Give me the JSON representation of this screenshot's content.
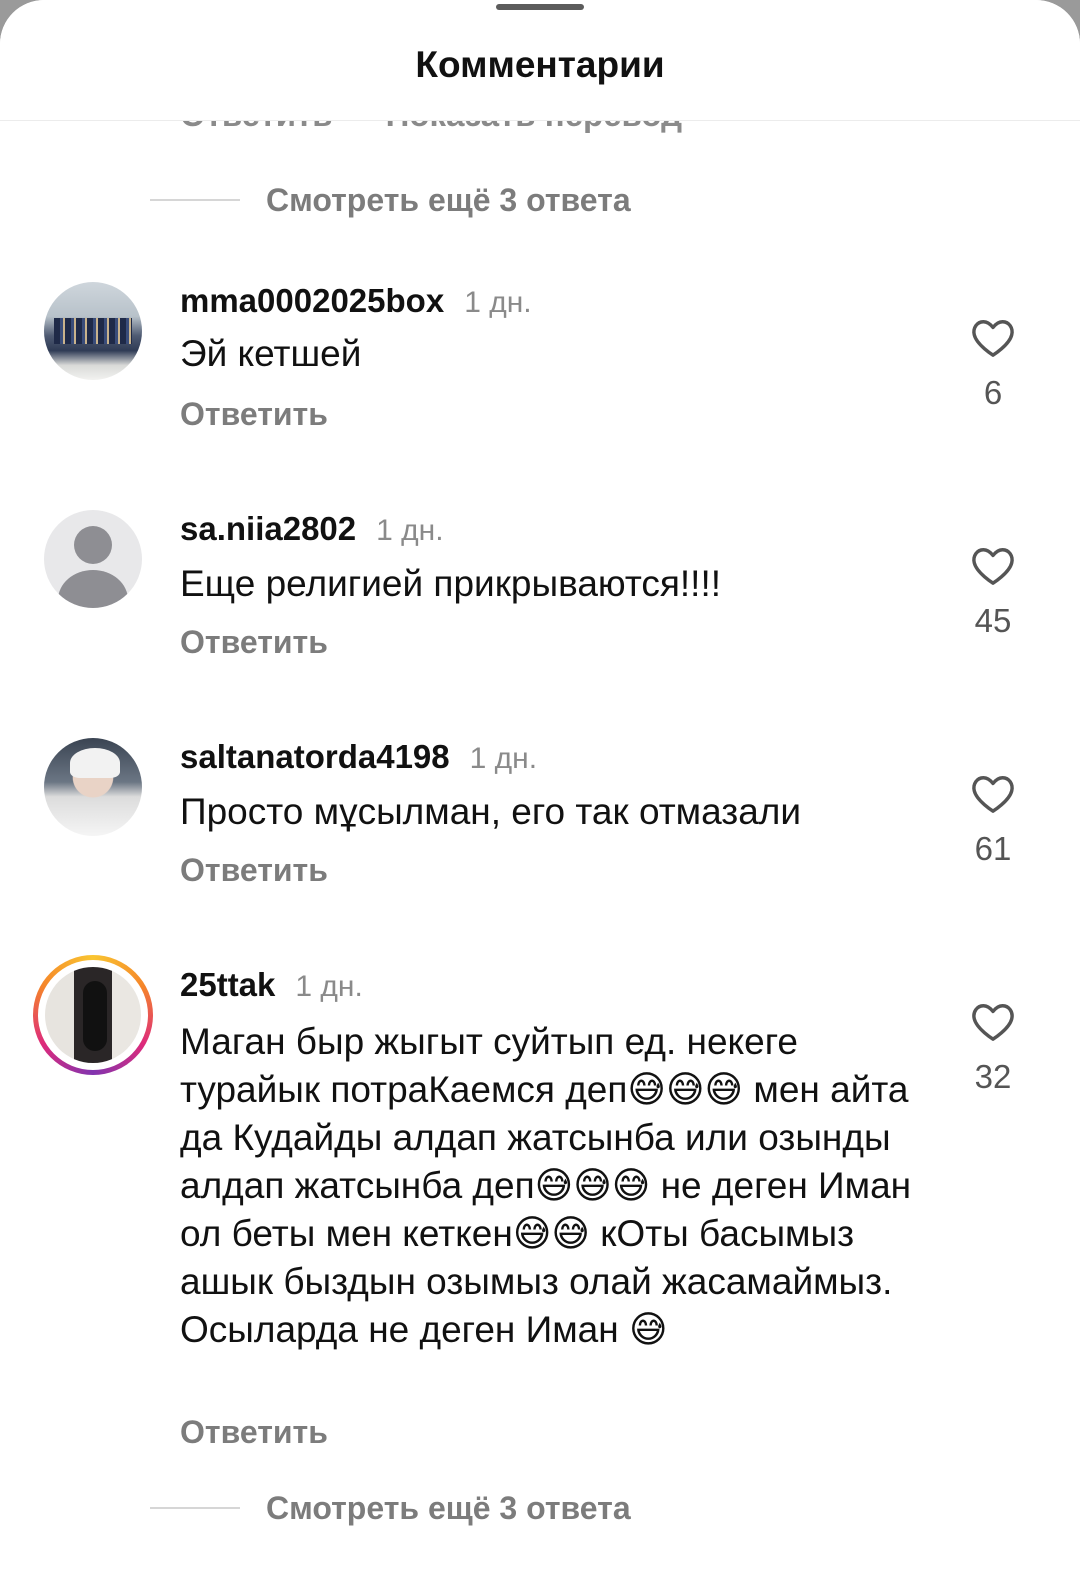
{
  "header": {
    "title": "Комментарии"
  },
  "clipped_row": {
    "reply_label": "Ответить",
    "translate_label": "Показать перевод"
  },
  "more_replies_top": {
    "label": "Смотреть ещё 3 ответа"
  },
  "comments": [
    {
      "username": "mma0002025box",
      "time": "1 дн.",
      "text": "Эй кетшей",
      "reply_label": "Ответить",
      "likes": "6",
      "avatar": "team-photo"
    },
    {
      "username": "sa.niia2802",
      "time": "1 дн.",
      "text": "Еще религией прикрываются!!!!",
      "reply_label": "Ответить",
      "likes": "45",
      "avatar": "default-person-icon"
    },
    {
      "username": "saltanatorda4198",
      "time": "1 дн.",
      "text": "Просто мұсылман, его так отмазали",
      "reply_label": "Ответить",
      "likes": "61",
      "avatar": "woman-in-cap-photo"
    },
    {
      "username": "25ttak",
      "time": "1 дн.",
      "text": "Маган быр жыгыт суйтып ед. некеге турайык потраКаемся деп😅😅😅 мен айта да Кудайды алдап жатсынба или озынды алдап жатсынба деп😅😅😅 не деген Иман ол беты мен кеткен😅😅 кОты басымыз ашык быздын озымыз олай жасамаймыз. Осыларда не деген Иман 😅",
      "reply_label": "Ответить",
      "likes": "32",
      "avatar": "story-ring-photo"
    }
  ],
  "more_replies_bottom": {
    "label": "Смотреть ещё 3 ответа"
  },
  "icons": {
    "like": "heart-outline-icon"
  },
  "colors": {
    "text_primary": "#111111",
    "text_secondary": "#7c7c7c",
    "divider": "#d6d6d6"
  }
}
